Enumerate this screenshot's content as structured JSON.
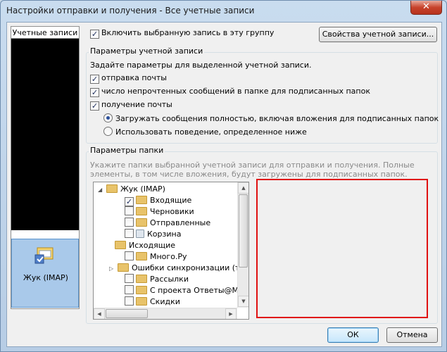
{
  "window": {
    "title": "Настройки отправки и получения - Все учетные записи",
    "close_glyph": "✕"
  },
  "accounts_tab": {
    "label": "Учетные записи"
  },
  "account_item": {
    "label": "Жук (IMAP)"
  },
  "top": {
    "include_label": "Включить выбранную запись в эту группу",
    "properties_button": "Свойства учетной записи..."
  },
  "account_params": {
    "legend": "Параметры учетной записи",
    "hint": "Задайте параметры для выделенной учетной записи.",
    "send_mail": "отправка почты",
    "unread_count": "число непрочтенных сообщений в папке для подписанных папок",
    "receive_mail": "получение почты",
    "radio_full": "Загружать сообщения полностью, включая вложения для подписанных папок",
    "radio_custom": "Использовать поведение, определенное ниже"
  },
  "folder_params": {
    "legend": "Параметры папки",
    "hint_line1": "Укажите папки выбранной учетной записи для отправки и получения. Полные",
    "hint_line2": "элементы, в том числе вложения, будут загружены для подписанных папок."
  },
  "tree": {
    "root": "Жук (IMAP)",
    "items": [
      {
        "label": "Входящие",
        "checked": true
      },
      {
        "label": "Черновики",
        "checked": false
      },
      {
        "label": "Отправленные",
        "checked": false
      },
      {
        "label": "Корзина",
        "checked": false
      },
      {
        "label": "Исходящие",
        "checked": false
      },
      {
        "label": "Много.Ру",
        "checked": false
      },
      {
        "label": "Ошибки синхронизации (т",
        "checked": false
      },
      {
        "label": "Рассылки",
        "checked": false
      },
      {
        "label": "С проекта Ответы@Mai",
        "checked": false
      },
      {
        "label": "Скидки",
        "checked": false
      }
    ]
  },
  "buttons": {
    "ok": "ОК",
    "cancel": "Отмена"
  },
  "glyphs": {
    "check": "✓",
    "expand_open": "◢",
    "expand_closed": "▷"
  },
  "colors": {
    "highlight_box": "#e01010",
    "selected_account_bg": "#a9c9ea"
  }
}
